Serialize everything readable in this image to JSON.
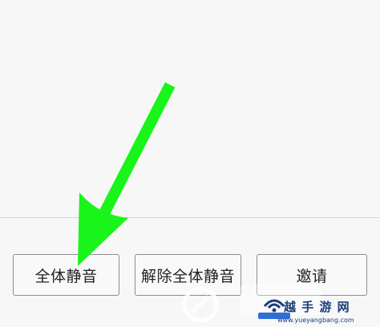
{
  "toolbar": {
    "mute_all_label": "全体静音",
    "unmute_all_label": "解除全体静音",
    "invite_label": "邀请"
  },
  "watermark": {
    "brand": "越 手 游 网",
    "url": "www.yueyangbang.com"
  },
  "colors": {
    "arrow": "#19f51a",
    "button_border": "#8e8e93",
    "background": "#f7f7f8",
    "watermark_blue": "#1a3d7a"
  }
}
